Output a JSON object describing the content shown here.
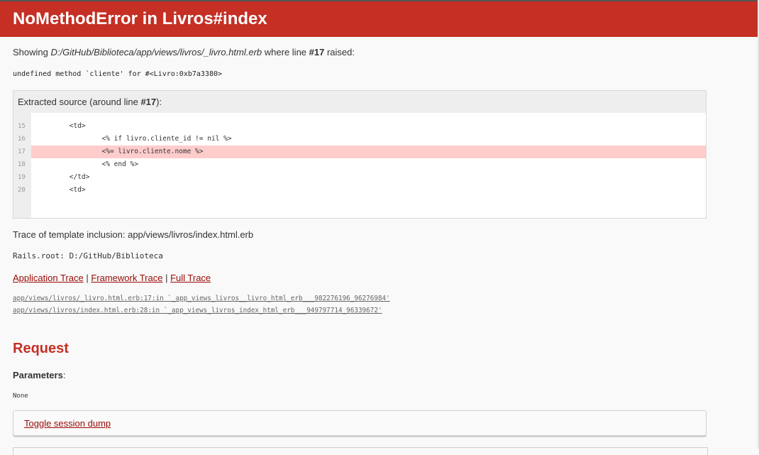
{
  "header": {
    "title": "NoMethodError in Livros#index"
  },
  "showing": {
    "prefix": "Showing ",
    "file": "D:/GitHub/Biblioteca/app/views/livros/_livro.html.erb",
    "middle": " where line ",
    "line": "#17",
    "suffix": " raised:"
  },
  "error_message": "undefined method `cliente' for #<Livro:0xb7a3380>",
  "source": {
    "title_prefix": "Extracted source (around line ",
    "title_line": "#17",
    "title_suffix": "):",
    "highlight_line": 17,
    "lines": [
      {
        "number": "15",
        "code": "        <td>"
      },
      {
        "number": "16",
        "code": "                <% if livro.cliente_id != nil %>"
      },
      {
        "number": "17",
        "code": "                <%= livro.cliente.nome %>"
      },
      {
        "number": "18",
        "code": "                <% end %>"
      },
      {
        "number": "19",
        "code": "        </td>"
      },
      {
        "number": "20",
        "code": "        <td>"
      }
    ]
  },
  "template_inclusion": "Trace of template inclusion: app/views/livros/index.html.erb",
  "rails_root": "Rails.root: D:/GitHub/Biblioteca",
  "trace_links": {
    "application": "Application Trace",
    "framework": "Framework Trace",
    "full": "Full Trace",
    "separator": " | "
  },
  "traces": [
    "app/views/livros/_livro.html.erb:17:in `_app_views_livros__livro_html_erb___982276196_96276984'",
    "app/views/livros/index.html.erb:28:in `_app_views_livros_index_html_erb___949797714_96339672'"
  ],
  "request": {
    "heading": "Request",
    "parameters_label": "Parameters",
    "parameters_colon": ":",
    "parameters_value": "None",
    "toggle_session": "Toggle session dump"
  },
  "colors": {
    "header_bg": "#c52f24",
    "link": "#980905",
    "highlight": "#ffcccc"
  }
}
